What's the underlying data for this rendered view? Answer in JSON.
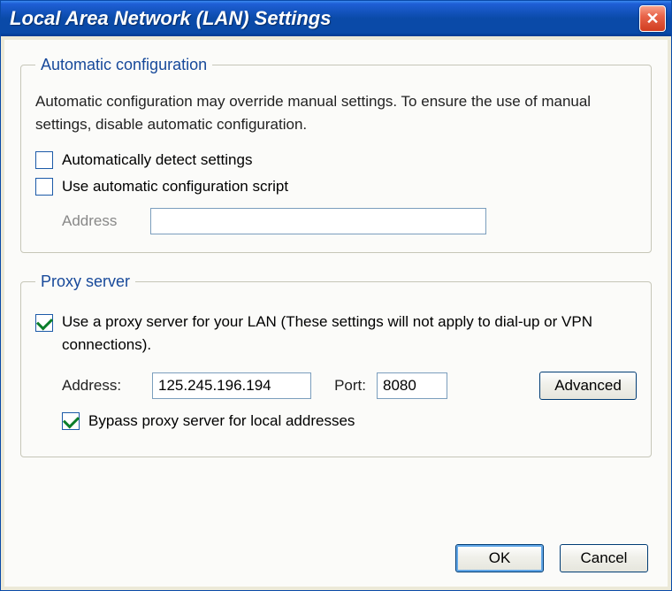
{
  "window": {
    "title": "Local Area Network (LAN) Settings"
  },
  "autoConfig": {
    "legend": "Automatic configuration",
    "desc": "Automatic configuration may override manual settings.  To ensure the use of manual settings, disable automatic configuration.",
    "autodetectLabel": "Automatically detect settings",
    "autodetectChecked": false,
    "useScriptLabel": "Use automatic configuration script",
    "useScriptChecked": false,
    "addressLabel": "Address",
    "addressValue": ""
  },
  "proxy": {
    "legend": "Proxy server",
    "useProxyLabel": "Use a proxy server for your LAN (These settings will not apply to dial-up or VPN connections).",
    "useProxyChecked": true,
    "addressLabel": "Address:",
    "addressValue": "125.245.196.194",
    "portLabel": "Port:",
    "portValue": "8080",
    "advancedLabel": "Advanced",
    "bypassLabel": "Bypass proxy server for local addresses",
    "bypassChecked": true
  },
  "buttons": {
    "ok": "OK",
    "cancel": "Cancel"
  }
}
